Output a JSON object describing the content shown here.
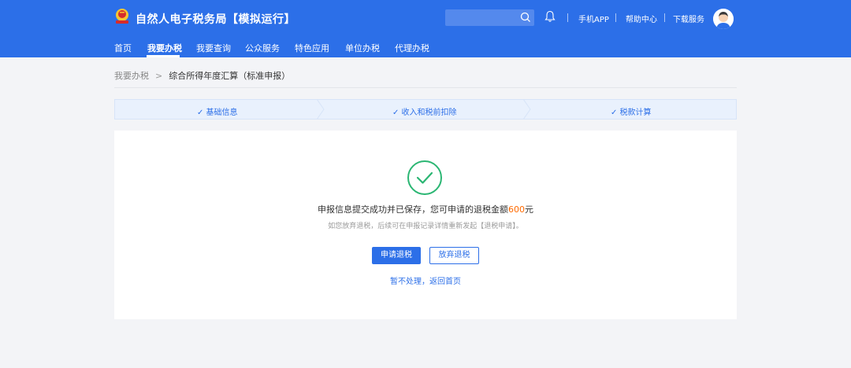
{
  "header": {
    "site_title": "自然人电子税务局【模拟运行】",
    "search_placeholder": "",
    "links": {
      "mobile_app": "手机APP",
      "help_center": "帮助中心",
      "download": "下载服务"
    },
    "nav": [
      "首页",
      "我要办税",
      "我要查询",
      "公众服务",
      "特色应用",
      "单位办税",
      "代理办税"
    ],
    "active_nav": "我要办税"
  },
  "breadcrumb": {
    "parent": "我要办税",
    "separator": ">",
    "current": "综合所得年度汇算（标准申报）"
  },
  "steps": [
    {
      "label": "✓ 基础信息"
    },
    {
      "label": "✓ 收入和税前扣除"
    },
    {
      "label": "✓ 税款计算"
    }
  ],
  "result": {
    "message_prefix": "申报信息提交成功并已保存，您可申请的退税金额",
    "amount": "600",
    "unit": "元",
    "sub_message": "如您放弃退税，后续可在申报记录详情重新发起【退税申请】。",
    "apply_button": "申请退税",
    "abandon_button": "放弃退税",
    "later_link": "暂不处理，返回首页"
  },
  "colors": {
    "primary": "#2c6fe8",
    "success": "#2bb673",
    "amount": "#ff6a00",
    "background": "#f3f4f7"
  }
}
